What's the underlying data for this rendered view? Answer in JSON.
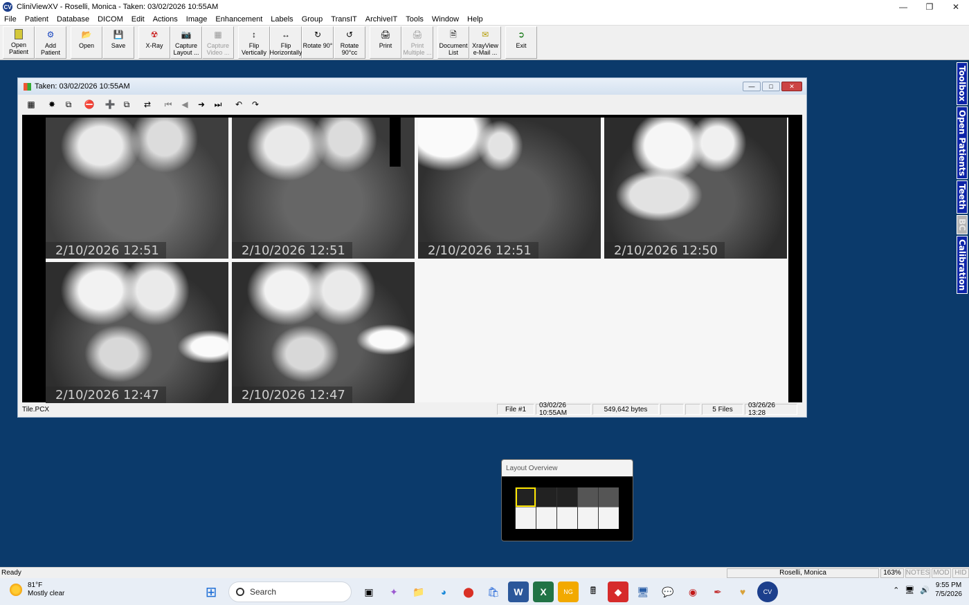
{
  "window": {
    "title": "CliniViewXV - Roselli, Monica - Taken: 03/02/2026  10:55AM",
    "app_icon_label": "CV"
  },
  "menu": [
    "File",
    "Patient",
    "Database",
    "DICOM",
    "Edit",
    "Actions",
    "Image",
    "Enhancement",
    "Labels",
    "Group",
    "TransIT",
    "ArchiveIT",
    "Tools",
    "Window",
    "Help"
  ],
  "toolbar": {
    "open_patient": "Open Patient",
    "add_patient": "Add Patient",
    "open": "Open",
    "save": "Save",
    "xray": "X-Ray",
    "capture_layout": "Capture Layout ...",
    "capture_video": "Capture Video ...",
    "flip_vertically": "Flip Vertically",
    "flip_horizontally": "Flip Horizontally",
    "rotate_90": "Rotate 90°",
    "rotate_90cc": "Rotate 90°cc",
    "print": "Print",
    "print_multiple": "Print Multiple ...",
    "document_list": "Document List",
    "xrayview_email": "XrayView e-Mail ...",
    "exit": "Exit"
  },
  "sidetabs": [
    "Toolbox",
    "Open Patients",
    "Teeth",
    "BC",
    "Calibration"
  ],
  "image_window": {
    "title": "Taken: 03/02/2026  10:55AM",
    "tiles": [
      {
        "stamp": "2/10/2026 12:51"
      },
      {
        "stamp": "2/10/2026 12:51"
      },
      {
        "stamp": "2/10/2026 12:51"
      },
      {
        "stamp": "2/10/2026 12:50"
      },
      {
        "stamp": "2/10/2026 12:47"
      },
      {
        "stamp": "2/10/2026 12:47"
      }
    ],
    "status": {
      "filename": "Tile.PCX",
      "file_num": "File #1",
      "date": "03/02/26  10:55AM",
      "bytes": "549,642 bytes",
      "files": "5 Files",
      "stamp": "03/26/26  13:28"
    }
  },
  "layout_overview": {
    "title": "Layout Overview"
  },
  "app_status": {
    "ready": "Ready",
    "patient": "Roselli, Monica",
    "zoom": "163%",
    "notes": "NOTES",
    "mod": "MOD",
    "hid": "HID"
  },
  "taskbar": {
    "weather_temp": "81°F",
    "weather_desc": "Mostly clear",
    "search_placeholder": "Search",
    "time": "9:55 PM",
    "date": "7/5/2026"
  }
}
